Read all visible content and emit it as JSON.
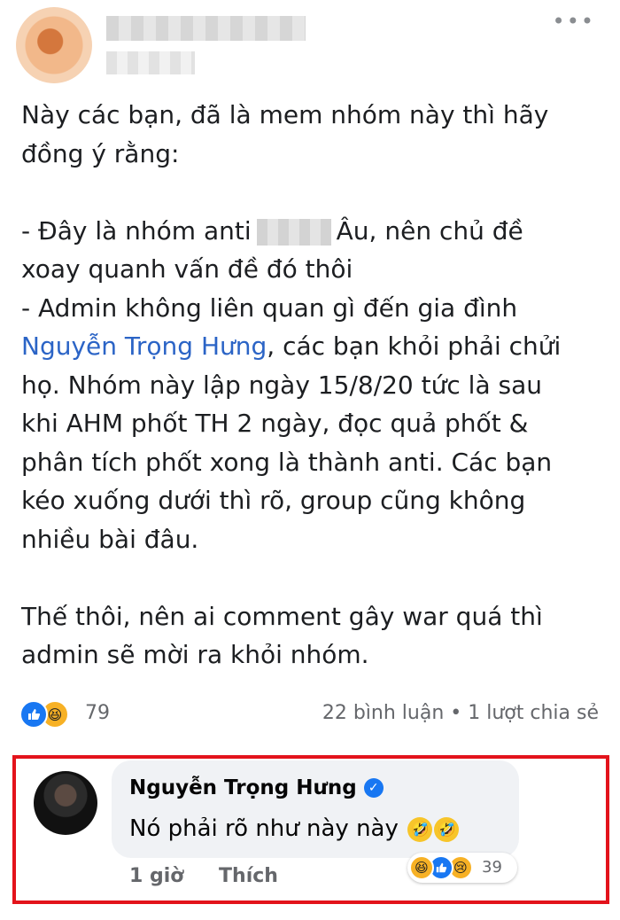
{
  "post": {
    "more_label": "•••",
    "lines": [
      "Này các bạn, đã là mem nhóm này thì hãy",
      "đồng ý rằng:",
      "",
      "- Đây là nhóm anti",
      "Âu, nên chủ đề",
      "xoay quanh vấn đề đó thôi",
      "- Admin không liên quan gì đến gia đình",
      "Nguyễn Trọng Hưng",
      ", các bạn khỏi phải chửi",
      "họ. Nhóm này lập ngày 15/8/20 tức là sau",
      "khi AHM phốt TH 2 ngày, đọc quả phốt &",
      "phân tích phốt xong là thành anti. Các bạn",
      "kéo xuống dưới thì rõ, group cũng không",
      "nhiều bài đâu.",
      "Thế thôi, nên ai comment gây war quá thì",
      "admin sẽ mời ra khỏi nhóm."
    ],
    "reactions": {
      "icons": [
        "like-icon",
        "haha-icon"
      ],
      "count": "79"
    },
    "stats": "22 bình luận • 1 lượt chia sẻ"
  },
  "comment": {
    "author": "Nguyễn Trọng Hưng",
    "verified_icon": "verified-badge-icon",
    "text": "Nó phải rõ như này này",
    "emojis": [
      "🤣",
      "🤣"
    ],
    "time": "1 giờ",
    "like_label": "Thích",
    "reactions": {
      "icons": [
        "haha-icon",
        "like-icon",
        "sad-icon"
      ],
      "count": "39"
    }
  },
  "colors": {
    "mention": "#2b64c6",
    "highlight_border": "#e3131b",
    "like_blue": "#1877f2",
    "haha_yellow": "#f7b125"
  }
}
